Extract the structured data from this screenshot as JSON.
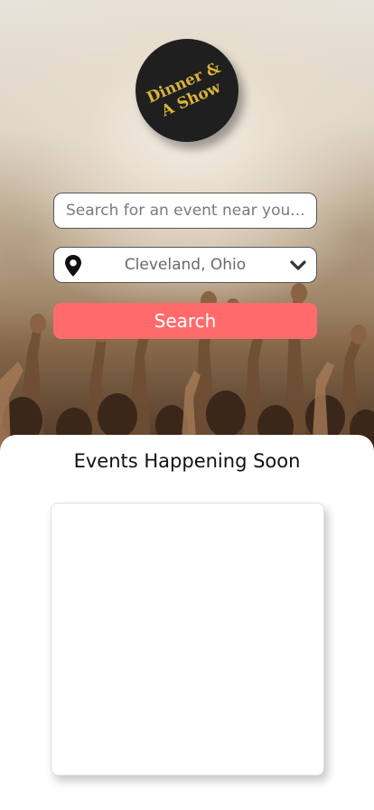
{
  "logo": {
    "line1": "Dinner &",
    "line2": "A Show",
    "text_color": "#d9b33a",
    "background_color": "#1f1f1f"
  },
  "search": {
    "placeholder": "Search for an event near you...",
    "value": ""
  },
  "location": {
    "icon": "map-pin-icon",
    "selected": "Cleveland, Ohio",
    "dropdown_icon": "chevron-down-icon"
  },
  "search_button": {
    "label": "Search",
    "color": "#ff6b6b"
  },
  "events": {
    "title": "Events Happening Soon",
    "cards": [
      {}
    ]
  }
}
